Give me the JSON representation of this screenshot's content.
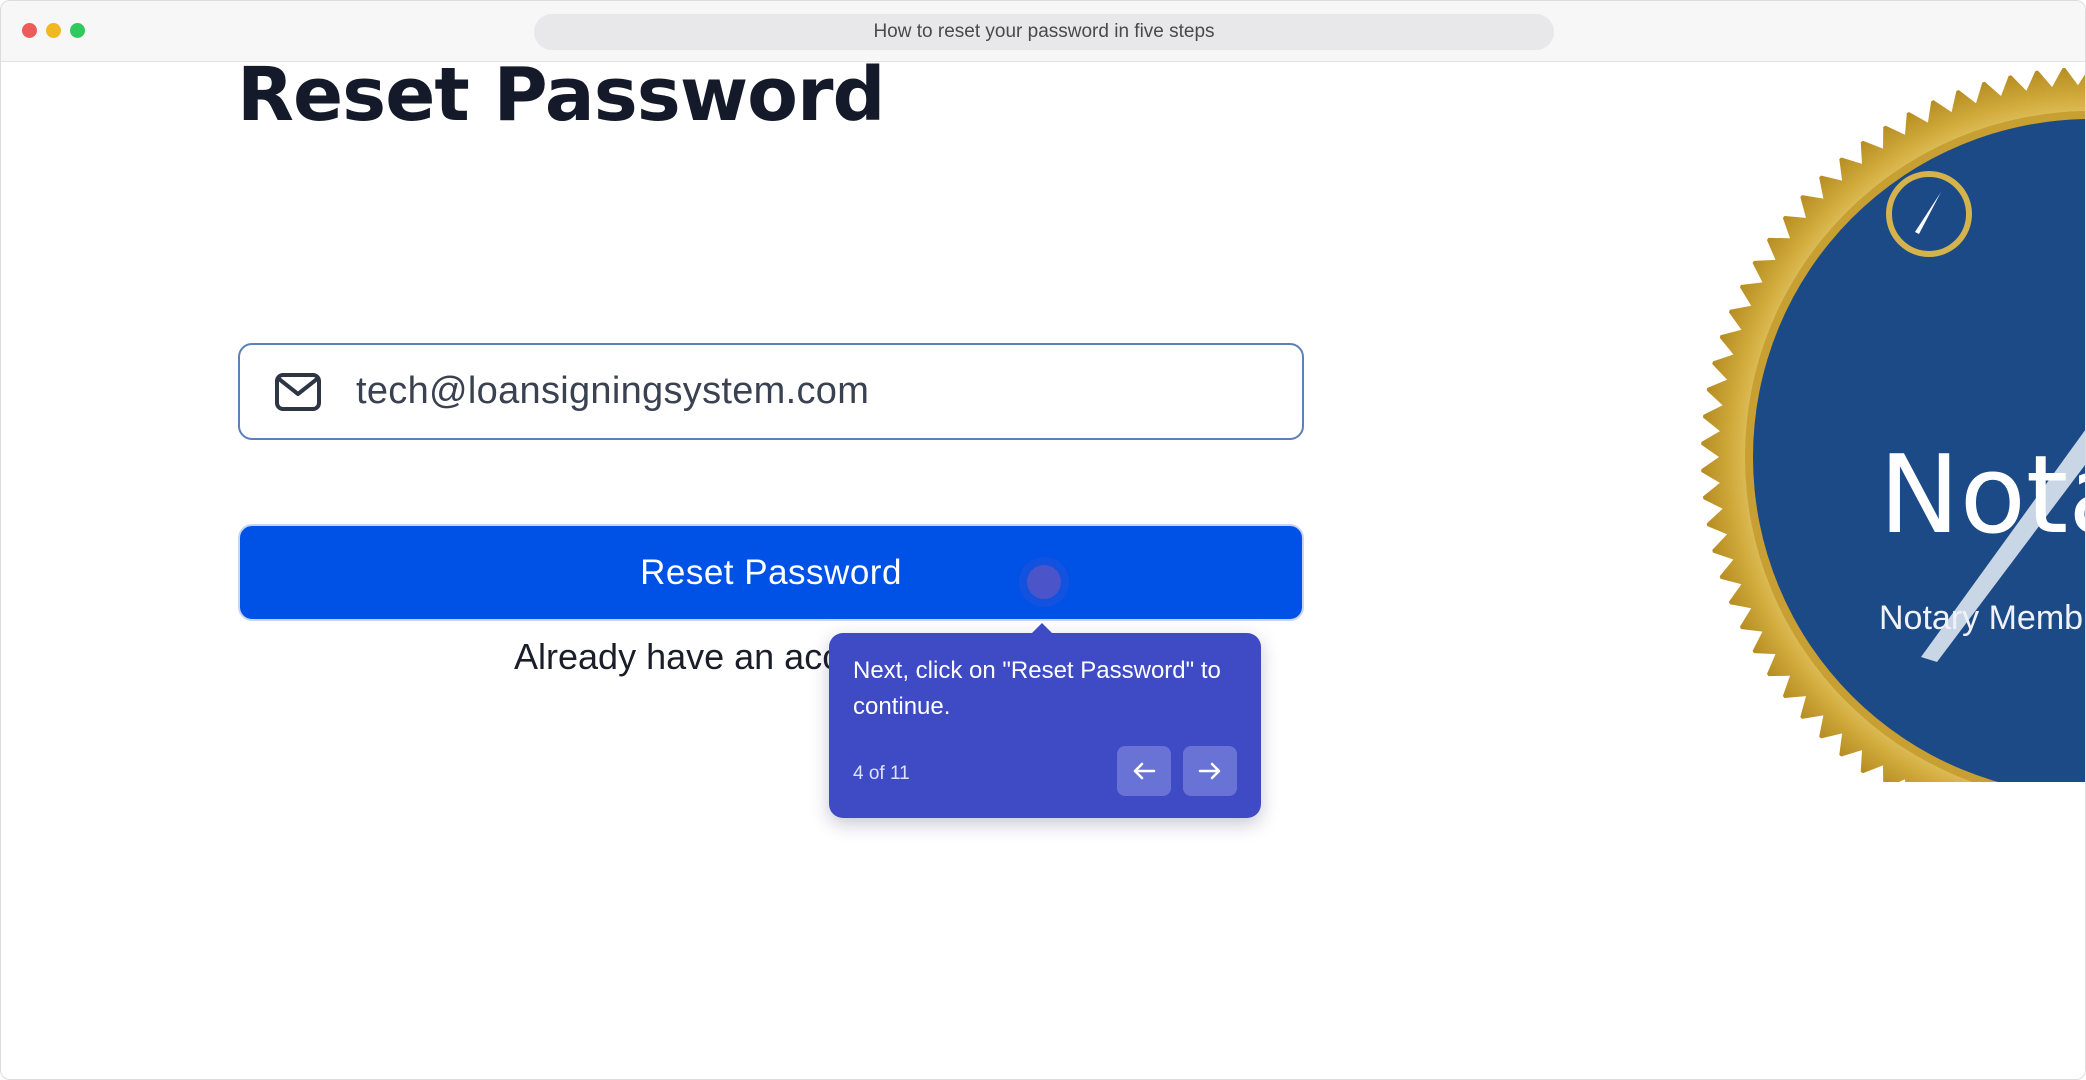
{
  "window": {
    "address_bar_text": "How to reset your password in five steps"
  },
  "page": {
    "title": "Reset Password",
    "email_field": {
      "value": "tech@loansigningsystem.com",
      "icon": "envelope-icon"
    },
    "reset_button_label": "Reset Password",
    "signin_text": "Already have an acc"
  },
  "seal": {
    "text_large": "Nota",
    "text_small": "Notary Memb",
    "icon": "pen-nib-icon"
  },
  "tooltip": {
    "text": "Next, click on \"Reset Password\" to continue.",
    "step_counter": "4 of 11",
    "prev_icon": "arrow-left-icon",
    "next_icon": "arrow-right-icon"
  },
  "colors": {
    "accent_button": "#0052e7",
    "tooltip_bg": "#3e4bc4",
    "seal_blue": "#1b4a86",
    "seal_gold": "#d4b24c"
  }
}
